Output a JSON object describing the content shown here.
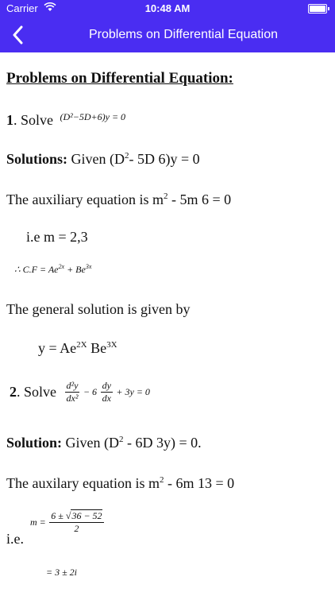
{
  "status_bar": {
    "carrier": "Carrier",
    "time": "10:48 AM"
  },
  "nav": {
    "title": "Problems on Differential Equation"
  },
  "content": {
    "heading": "Problems on Differential Equation:",
    "p1": {
      "number": "1",
      "text": ". Solve",
      "equation": "(D²−5D+6)y = 0"
    },
    "s1": {
      "label": "Solutions:",
      "text_a": " Given (D",
      "sup": "2",
      "text_b": "- 5D 6)y = 0"
    },
    "aux1": {
      "text_a": "The auxiliary equation is m",
      "sup": "2",
      "text_b": " - 5m 6 = 0"
    },
    "ie1": "i.e m = 2,3",
    "cf": {
      "prefix": "∴ C.F = Ae",
      "sup1": "2x",
      "mid": " + Be",
      "sup2": "3x"
    },
    "general": "The general solution is given by",
    "y": {
      "a": "y = Ae",
      "sup1": "2X",
      "b": " Be",
      "sup2": "3X"
    },
    "p2": {
      "number": "2",
      "text": ". Solve",
      "frac1_num": "d²y",
      "frac1_den": "dx²",
      "mid": "− 6",
      "frac2_num": "dy",
      "frac2_den": "dx",
      "end": "+ 3y = 0"
    },
    "s2": {
      "label": "Solution:",
      "text_a": " Given (D",
      "sup": "2",
      "text_b": " - 6D 3y) = 0."
    },
    "aux2": {
      "text_a": "The auxilary equation is m",
      "sup": "2",
      "text_b": " - 6m 13 = 0"
    },
    "ie2": "i.e.",
    "m_eq": {
      "lhs": "m =",
      "num_a": "6 ± ",
      "num_sqrt": "36 − 52",
      "den": "2"
    },
    "m_result": "= 3 ± 2i"
  }
}
